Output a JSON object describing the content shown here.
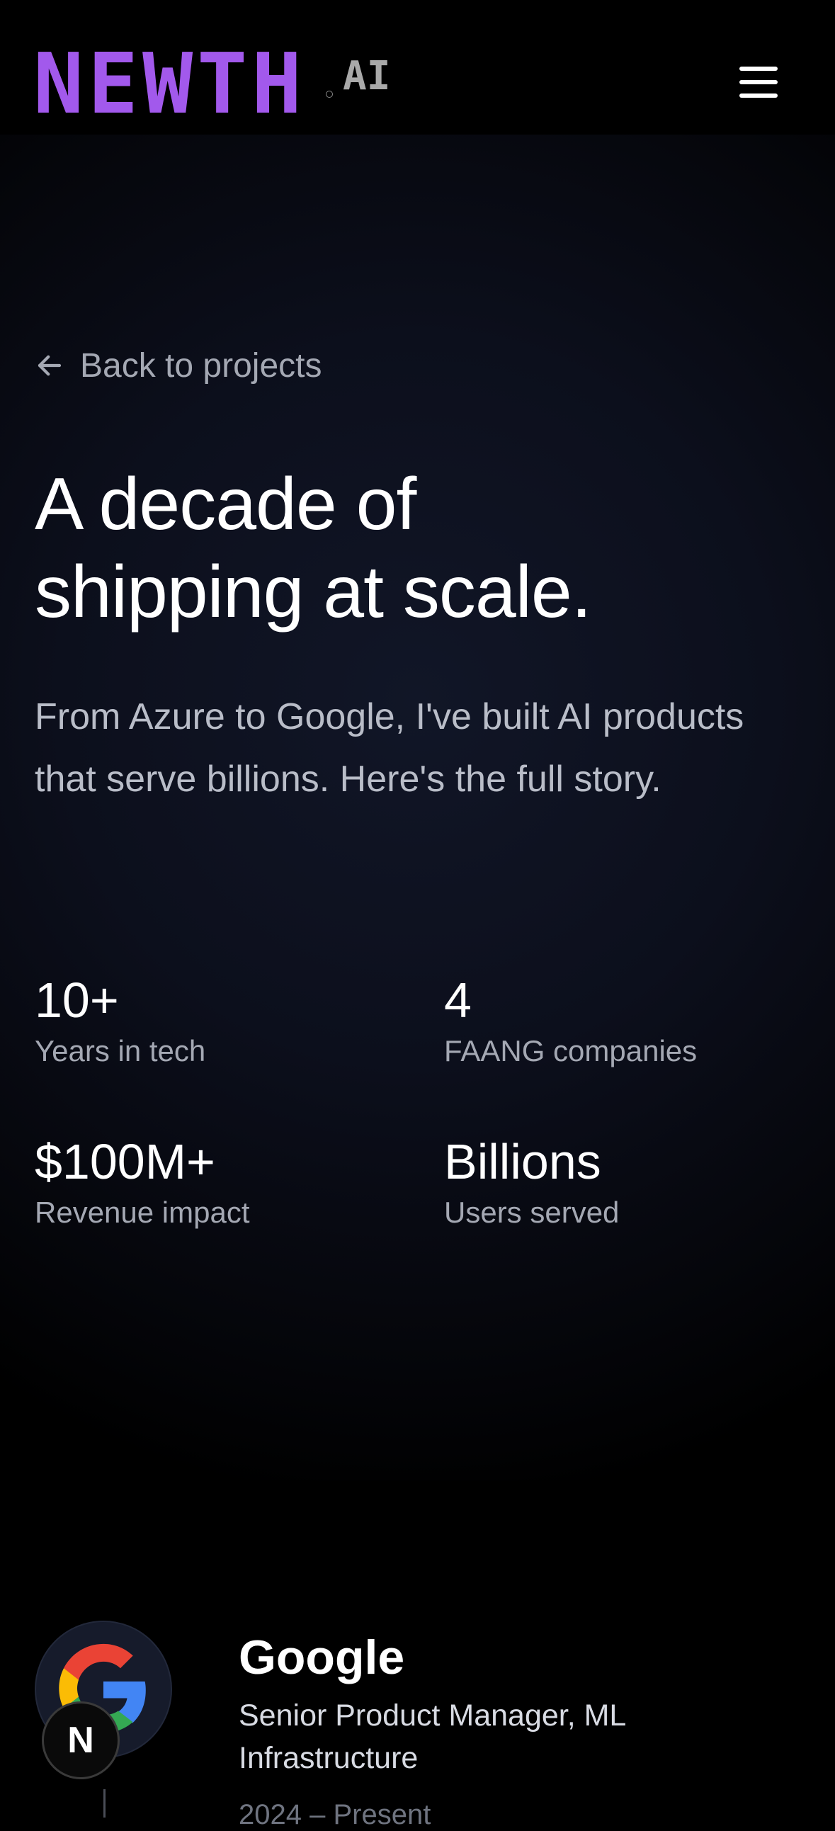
{
  "header": {
    "logo_text": "NEWTH",
    "logo_suffix": "AI",
    "menu_icon": "hamburger-menu-icon"
  },
  "back_link": {
    "label": "Back to projects",
    "icon": "arrow-left-icon"
  },
  "hero": {
    "title_line1": "A decade of",
    "title_line2": "shipping at scale.",
    "lead": "From Azure to Google, I've built AI products that serve billions. Here's the full story."
  },
  "stats": [
    {
      "value": "10+",
      "label": "Years in tech"
    },
    {
      "value": "4",
      "label": "FAANG companies"
    },
    {
      "value": "$100M+",
      "label": "Revenue impact"
    },
    {
      "value": "Billions",
      "label": "Users served"
    }
  ],
  "timeline": {
    "entries": [
      {
        "company": "Google",
        "logo_icon": "google-logo-icon",
        "role": "Senior Product Manager, ML Infrastructure",
        "dates": "2024 – Present"
      }
    ],
    "badge_letter": "N"
  },
  "colors": {
    "brand_purple": "#a259ec",
    "background": "#000000",
    "muted_text": "#a4a8b3"
  }
}
